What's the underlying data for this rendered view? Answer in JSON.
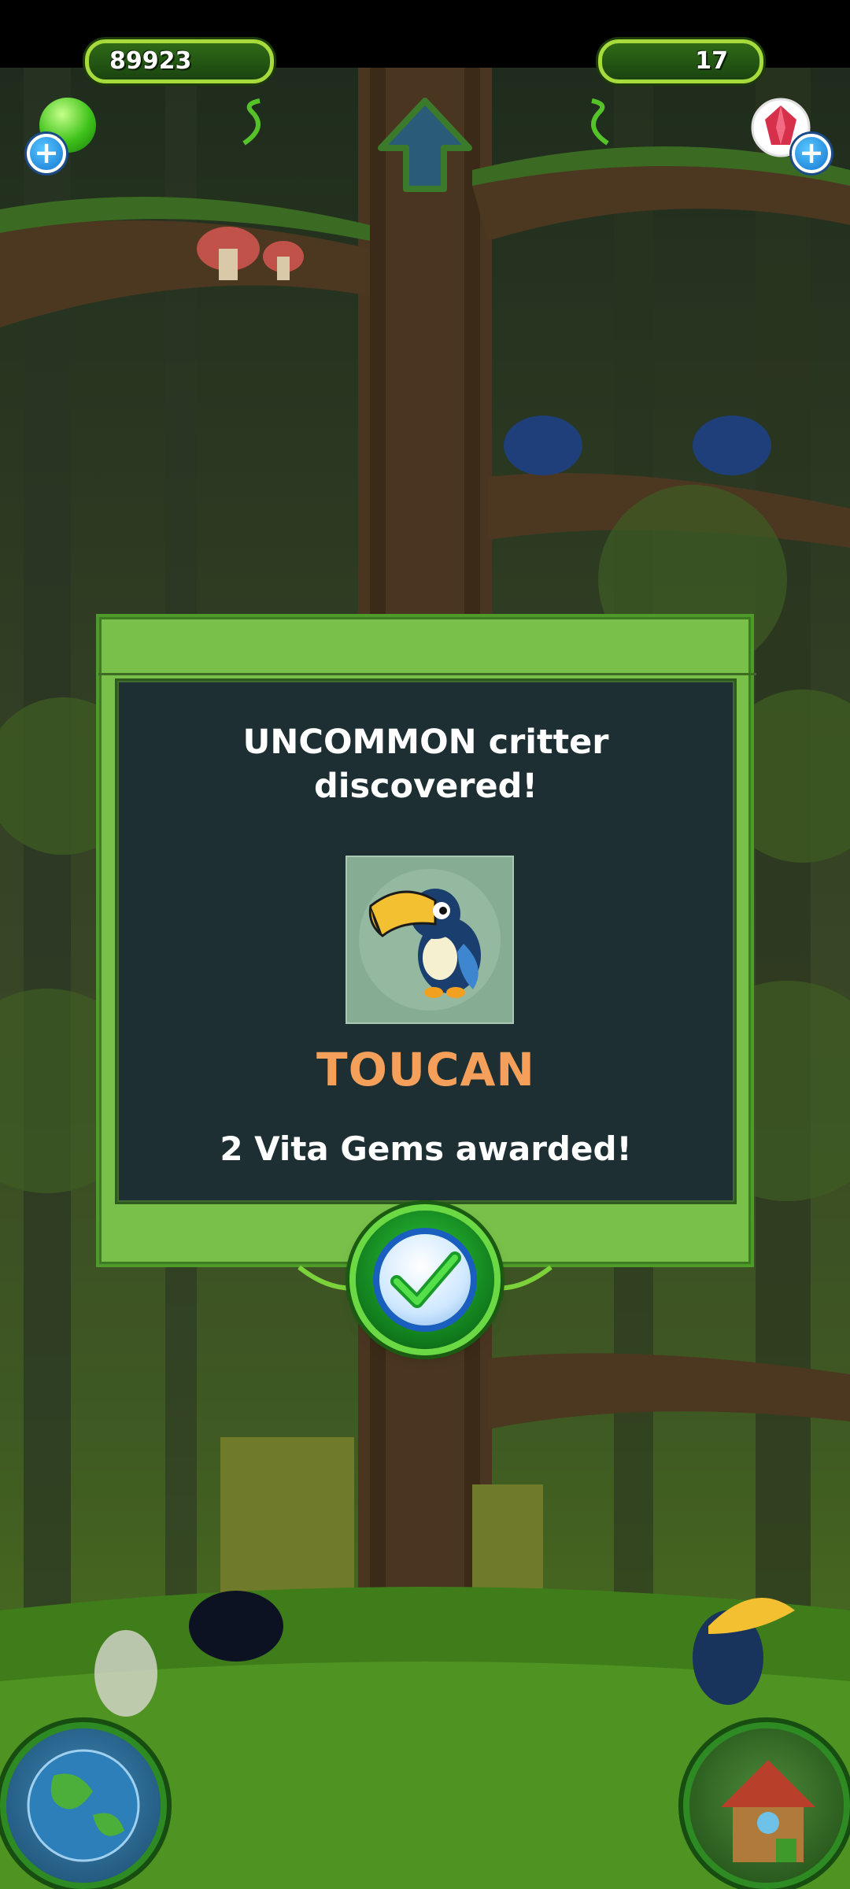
{
  "currency": {
    "goo_amount": "89923",
    "gems_amount": "17"
  },
  "dialog": {
    "title": "UNCOMMON critter discovered!",
    "critter_name": "TOUCAN",
    "award": "2 Vita Gems awarded!"
  },
  "icons": {
    "goo": "green-goo-icon",
    "gem": "red-gem-icon",
    "plus": "plus-icon",
    "confirm": "checkmark-icon",
    "world": "globe-icon",
    "home": "treehouse-icon",
    "up": "up-arrow-icon"
  },
  "colors": {
    "accent_green": "#78c04a",
    "panel_dark": "#1e2f33",
    "critter_name": "#f4a05a"
  }
}
